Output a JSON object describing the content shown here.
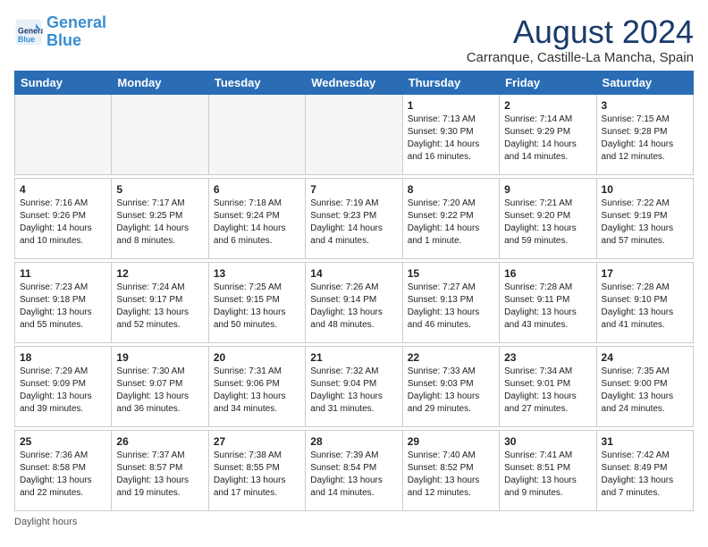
{
  "header": {
    "logo_line1": "General",
    "logo_line2": "Blue",
    "month_title": "August 2024",
    "subtitle": "Carranque, Castille-La Mancha, Spain"
  },
  "days_of_week": [
    "Sunday",
    "Monday",
    "Tuesday",
    "Wednesday",
    "Thursday",
    "Friday",
    "Saturday"
  ],
  "footer": {
    "daylight_label": "Daylight hours"
  },
  "weeks": [
    {
      "days": [
        {
          "num": "",
          "detail": "",
          "empty": true
        },
        {
          "num": "",
          "detail": "",
          "empty": true
        },
        {
          "num": "",
          "detail": "",
          "empty": true
        },
        {
          "num": "",
          "detail": "",
          "empty": true
        },
        {
          "num": "1",
          "detail": "Sunrise: 7:13 AM\nSunset: 9:30 PM\nDaylight: 14 hours\nand 16 minutes."
        },
        {
          "num": "2",
          "detail": "Sunrise: 7:14 AM\nSunset: 9:29 PM\nDaylight: 14 hours\nand 14 minutes."
        },
        {
          "num": "3",
          "detail": "Sunrise: 7:15 AM\nSunset: 9:28 PM\nDaylight: 14 hours\nand 12 minutes."
        }
      ]
    },
    {
      "days": [
        {
          "num": "4",
          "detail": "Sunrise: 7:16 AM\nSunset: 9:26 PM\nDaylight: 14 hours\nand 10 minutes."
        },
        {
          "num": "5",
          "detail": "Sunrise: 7:17 AM\nSunset: 9:25 PM\nDaylight: 14 hours\nand 8 minutes."
        },
        {
          "num": "6",
          "detail": "Sunrise: 7:18 AM\nSunset: 9:24 PM\nDaylight: 14 hours\nand 6 minutes."
        },
        {
          "num": "7",
          "detail": "Sunrise: 7:19 AM\nSunset: 9:23 PM\nDaylight: 14 hours\nand 4 minutes."
        },
        {
          "num": "8",
          "detail": "Sunrise: 7:20 AM\nSunset: 9:22 PM\nDaylight: 14 hours\nand 1 minute."
        },
        {
          "num": "9",
          "detail": "Sunrise: 7:21 AM\nSunset: 9:20 PM\nDaylight: 13 hours\nand 59 minutes."
        },
        {
          "num": "10",
          "detail": "Sunrise: 7:22 AM\nSunset: 9:19 PM\nDaylight: 13 hours\nand 57 minutes."
        }
      ]
    },
    {
      "days": [
        {
          "num": "11",
          "detail": "Sunrise: 7:23 AM\nSunset: 9:18 PM\nDaylight: 13 hours\nand 55 minutes."
        },
        {
          "num": "12",
          "detail": "Sunrise: 7:24 AM\nSunset: 9:17 PM\nDaylight: 13 hours\nand 52 minutes."
        },
        {
          "num": "13",
          "detail": "Sunrise: 7:25 AM\nSunset: 9:15 PM\nDaylight: 13 hours\nand 50 minutes."
        },
        {
          "num": "14",
          "detail": "Sunrise: 7:26 AM\nSunset: 9:14 PM\nDaylight: 13 hours\nand 48 minutes."
        },
        {
          "num": "15",
          "detail": "Sunrise: 7:27 AM\nSunset: 9:13 PM\nDaylight: 13 hours\nand 46 minutes."
        },
        {
          "num": "16",
          "detail": "Sunrise: 7:28 AM\nSunset: 9:11 PM\nDaylight: 13 hours\nand 43 minutes."
        },
        {
          "num": "17",
          "detail": "Sunrise: 7:28 AM\nSunset: 9:10 PM\nDaylight: 13 hours\nand 41 minutes."
        }
      ]
    },
    {
      "days": [
        {
          "num": "18",
          "detail": "Sunrise: 7:29 AM\nSunset: 9:09 PM\nDaylight: 13 hours\nand 39 minutes."
        },
        {
          "num": "19",
          "detail": "Sunrise: 7:30 AM\nSunset: 9:07 PM\nDaylight: 13 hours\nand 36 minutes."
        },
        {
          "num": "20",
          "detail": "Sunrise: 7:31 AM\nSunset: 9:06 PM\nDaylight: 13 hours\nand 34 minutes."
        },
        {
          "num": "21",
          "detail": "Sunrise: 7:32 AM\nSunset: 9:04 PM\nDaylight: 13 hours\nand 31 minutes."
        },
        {
          "num": "22",
          "detail": "Sunrise: 7:33 AM\nSunset: 9:03 PM\nDaylight: 13 hours\nand 29 minutes."
        },
        {
          "num": "23",
          "detail": "Sunrise: 7:34 AM\nSunset: 9:01 PM\nDaylight: 13 hours\nand 27 minutes."
        },
        {
          "num": "24",
          "detail": "Sunrise: 7:35 AM\nSunset: 9:00 PM\nDaylight: 13 hours\nand 24 minutes."
        }
      ]
    },
    {
      "days": [
        {
          "num": "25",
          "detail": "Sunrise: 7:36 AM\nSunset: 8:58 PM\nDaylight: 13 hours\nand 22 minutes."
        },
        {
          "num": "26",
          "detail": "Sunrise: 7:37 AM\nSunset: 8:57 PM\nDaylight: 13 hours\nand 19 minutes."
        },
        {
          "num": "27",
          "detail": "Sunrise: 7:38 AM\nSunset: 8:55 PM\nDaylight: 13 hours\nand 17 minutes."
        },
        {
          "num": "28",
          "detail": "Sunrise: 7:39 AM\nSunset: 8:54 PM\nDaylight: 13 hours\nand 14 minutes."
        },
        {
          "num": "29",
          "detail": "Sunrise: 7:40 AM\nSunset: 8:52 PM\nDaylight: 13 hours\nand 12 minutes."
        },
        {
          "num": "30",
          "detail": "Sunrise: 7:41 AM\nSunset: 8:51 PM\nDaylight: 13 hours\nand 9 minutes."
        },
        {
          "num": "31",
          "detail": "Sunrise: 7:42 AM\nSunset: 8:49 PM\nDaylight: 13 hours\nand 7 minutes."
        }
      ]
    }
  ]
}
